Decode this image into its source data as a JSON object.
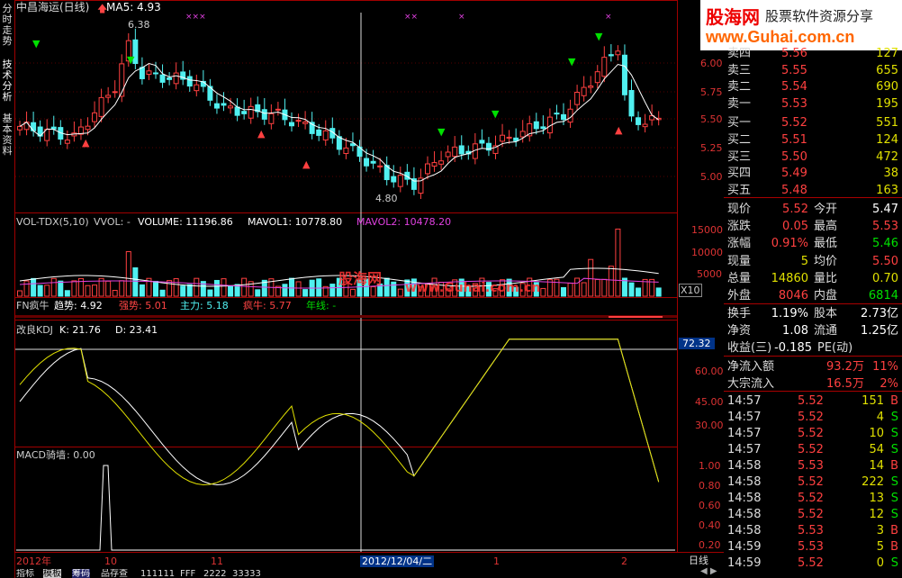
{
  "stock_title": "中昌海运(日线)",
  "left_tabs": [
    "分时走势",
    "技术分析",
    "基本资料"
  ],
  "brand": {
    "name": "股海网",
    "slogan": "股票软件资源分享",
    "url": "www.Guhai.com.cn"
  },
  "watermark": {
    "name": "股海网",
    "url": "www.Guhai.com.cn"
  },
  "price_panel": {
    "ma_label": "MA5: 4.93",
    "high_note": "6.38",
    "low_note": "4.80",
    "axis": [
      "6.00",
      "5.75",
      "5.50",
      "5.25",
      "5.00"
    ]
  },
  "vol_panel": {
    "header": "VOL-TDX(5,10)",
    "vvol": "VVOL: -",
    "volume": "VOLUME: 11196.86",
    "mavol1": "MAVOL1: 10778.80",
    "mavol2": "MAVOL2: 10478.20",
    "axis": [
      "15000",
      "10000",
      "5000"
    ],
    "unit": "X10"
  },
  "fn_panel": {
    "name": "FN疯牛",
    "trend": "趋势: 4.92",
    "strong": "强势: 5.01",
    "main": "主力: 5.18",
    "crazy": "疯牛: 5.77",
    "year": "年线: -"
  },
  "kdj_panel": {
    "name": "改良KDJ",
    "k": "K: 21.76",
    "d": "D: 23.41",
    "axis": [
      "60.00",
      "45.00",
      "30.00"
    ],
    "current": "72.32"
  },
  "macd_panel": {
    "name": "MACD骑墙",
    "value": ": 0.00",
    "axis": [
      "1.00",
      "0.80",
      "0.60",
      "0.40",
      "0.20"
    ]
  },
  "date_axis": {
    "labels": [
      "2012年",
      "10",
      "11",
      "1",
      "2"
    ],
    "cursor": "2012/12/04/二",
    "period": "日线"
  },
  "bottom_tabs": [
    "指标",
    "模板",
    "筹码",
    "品存查",
    "111111",
    "FFF",
    "2222",
    "33333"
  ],
  "order_book": [
    {
      "label": "卖四",
      "price": "5.56",
      "vol": "127"
    },
    {
      "label": "卖三",
      "price": "5.55",
      "vol": "655"
    },
    {
      "label": "卖二",
      "price": "5.54",
      "vol": "690"
    },
    {
      "label": "卖一",
      "price": "5.53",
      "vol": "195"
    },
    {
      "label": "买一",
      "price": "5.52",
      "vol": "551"
    },
    {
      "label": "买二",
      "price": "5.51",
      "vol": "124"
    },
    {
      "label": "买三",
      "price": "5.50",
      "vol": "472"
    },
    {
      "label": "买四",
      "price": "5.49",
      "vol": "38"
    },
    {
      "label": "买五",
      "price": "5.48",
      "vol": "163"
    }
  ],
  "quote": [
    {
      "l1": "现价",
      "v1": "5.52",
      "l2": "今开",
      "v2": "5.47"
    },
    {
      "l1": "涨跌",
      "v1": "0.05",
      "l2": "最高",
      "v2": "5.53"
    },
    {
      "l1": "涨幅",
      "v1": "0.91%",
      "l2": "最低",
      "v2": "5.46"
    },
    {
      "l1": "现量",
      "v1": "5",
      "l2": "均价",
      "v2": "5.50"
    },
    {
      "l1": "总量",
      "v1": "14860",
      "l2": "量比",
      "v2": "0.70"
    },
    {
      "l1": "外盘",
      "v1": "8046",
      "l2": "内盘",
      "v2": "6814"
    }
  ],
  "fundamentals": [
    {
      "l1": "换手",
      "v1": "1.19%",
      "l2": "股本",
      "v2": "2.73亿"
    },
    {
      "l1": "净资",
      "v1": "1.08",
      "l2": "流通",
      "v2": "1.25亿"
    },
    {
      "l1": "收益(三)",
      "v1": "-0.185",
      "l2": "PE(动)",
      "v2": ""
    }
  ],
  "flow": [
    {
      "label": "净流入额",
      "v1": "93.2万",
      "v2": "11%"
    },
    {
      "label": "大宗流入",
      "v1": "16.5万",
      "v2": "2%"
    }
  ],
  "ticks": [
    {
      "t": "14:57",
      "p": "5.52",
      "v": "151",
      "s": "B"
    },
    {
      "t": "14:57",
      "p": "5.52",
      "v": "4",
      "s": "S"
    },
    {
      "t": "14:57",
      "p": "5.52",
      "v": "10",
      "s": "S"
    },
    {
      "t": "14:57",
      "p": "5.52",
      "v": "54",
      "s": "S"
    },
    {
      "t": "14:58",
      "p": "5.53",
      "v": "14",
      "s": "B"
    },
    {
      "t": "14:58",
      "p": "5.52",
      "v": "222",
      "s": "S"
    },
    {
      "t": "14:58",
      "p": "5.52",
      "v": "13",
      "s": "S"
    },
    {
      "t": "14:58",
      "p": "5.52",
      "v": "12",
      "s": "S"
    },
    {
      "t": "14:58",
      "p": "5.53",
      "v": "3",
      "s": "B"
    },
    {
      "t": "14:59",
      "p": "5.53",
      "v": "5",
      "s": "B"
    },
    {
      "t": "14:59",
      "p": "5.52",
      "v": "0",
      "s": "S"
    }
  ],
  "colors": {
    "red": "#ff4040",
    "green": "#00e000",
    "cyan": "#50f0f0",
    "yellow": "#e0e000",
    "white": "#ffffff",
    "frame": "#a00000"
  }
}
